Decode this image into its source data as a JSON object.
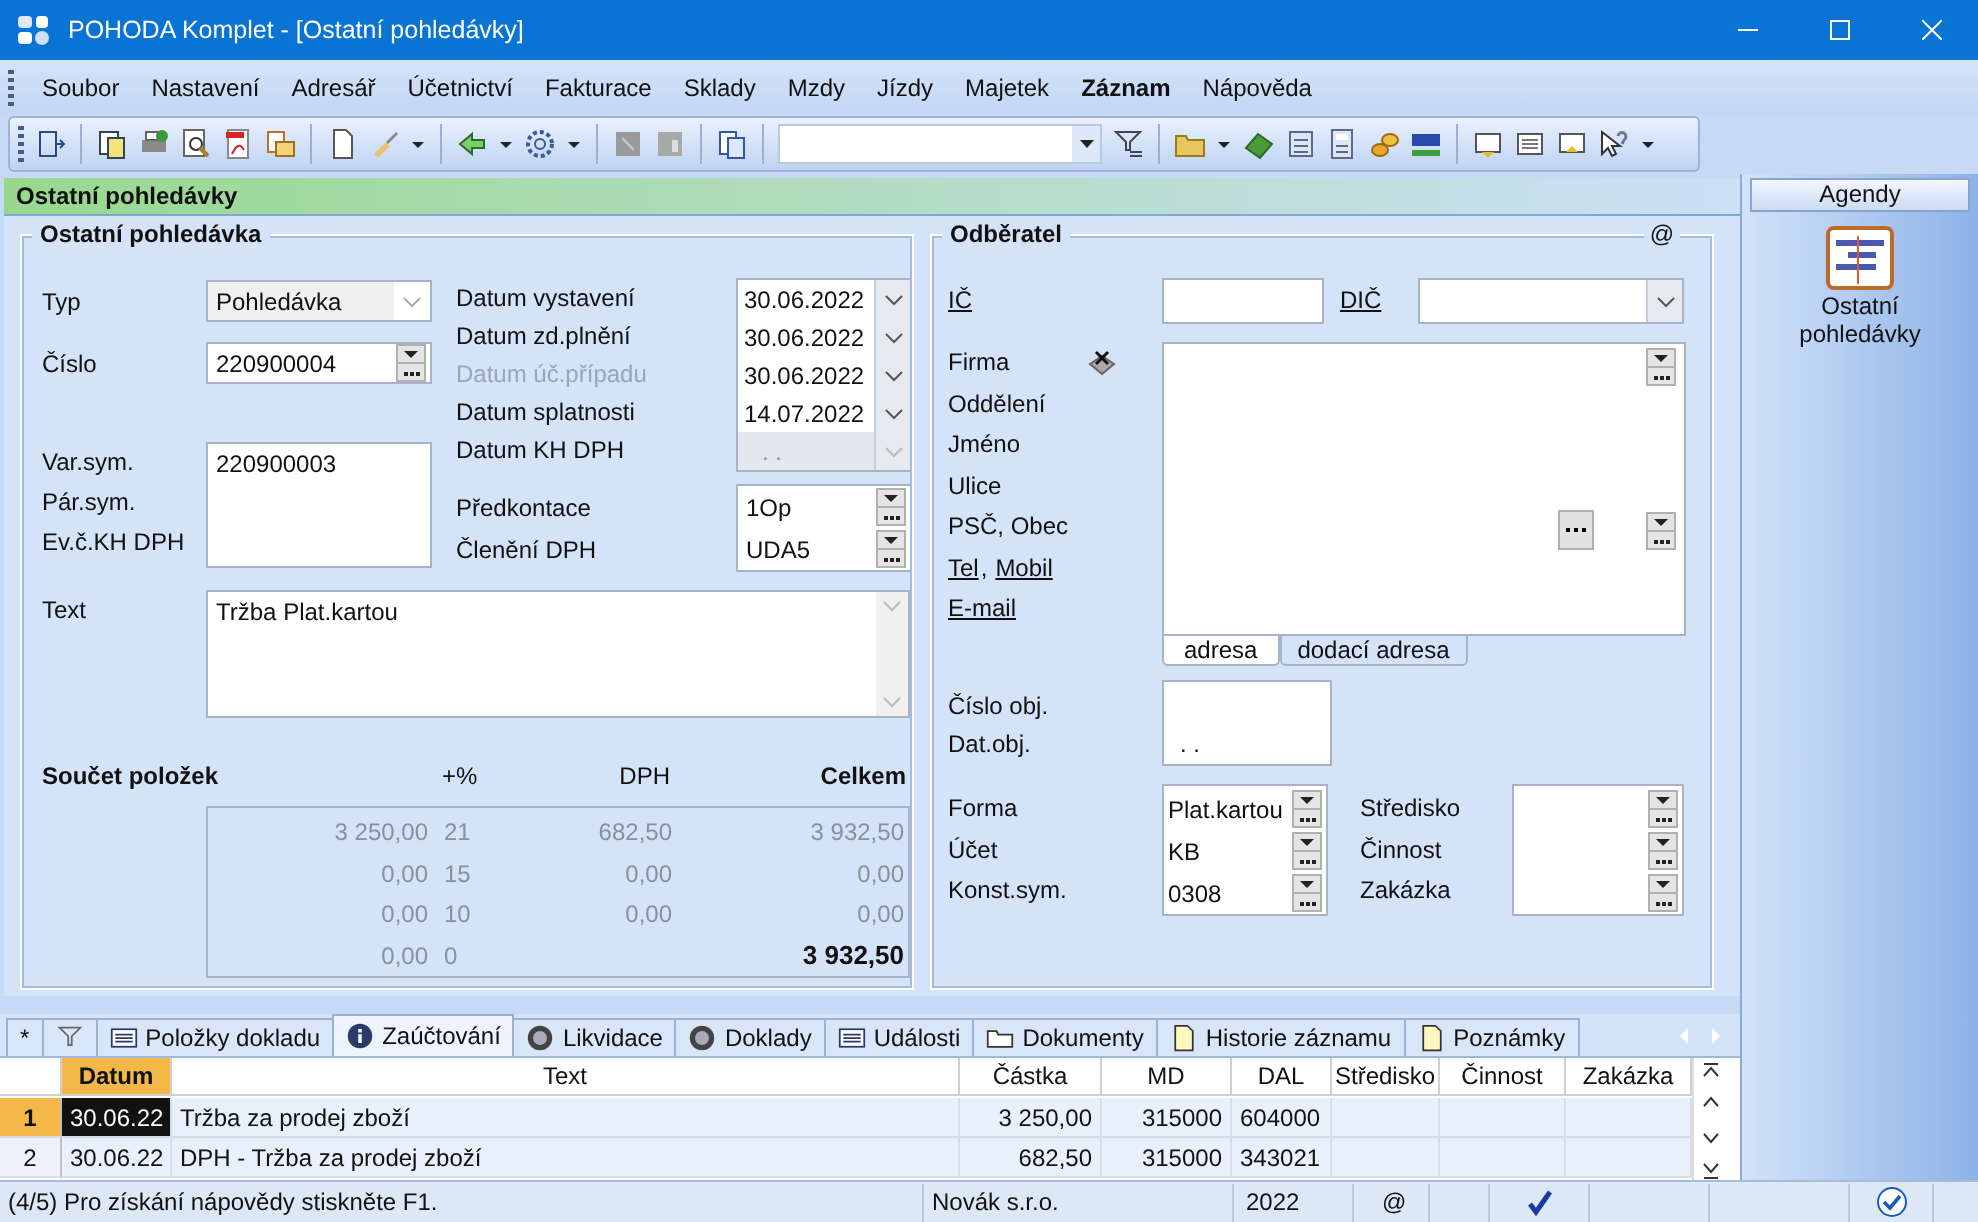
{
  "window": {
    "title": "POHODA Komplet - [Ostatní pohledávky]"
  },
  "menu": [
    {
      "label": "Soubor",
      "bold": false
    },
    {
      "label": "Nastavení",
      "bold": false
    },
    {
      "label": "Adresář",
      "bold": false
    },
    {
      "label": "Účetnictví",
      "bold": false
    },
    {
      "label": "Fakturace",
      "bold": false
    },
    {
      "label": "Sklady",
      "bold": false
    },
    {
      "label": "Mzdy",
      "bold": false
    },
    {
      "label": "Jízdy",
      "bold": false
    },
    {
      "label": "Majetek",
      "bold": false
    },
    {
      "label": "Záznam",
      "bold": true
    },
    {
      "label": "Nápověda",
      "bold": false
    }
  ],
  "agenda_header": "Ostatní pohledávky",
  "document": {
    "title": "Ostatní pohledávka",
    "typ": {
      "label": "Typ",
      "value": "Pohledávka"
    },
    "cislo": {
      "label": "Číslo",
      "value": "220900004"
    },
    "symbols": {
      "labels": [
        "Var.sym.",
        "Pár.sym.",
        "Ev.č.KH DPH"
      ],
      "values": [
        "220900003"
      ]
    },
    "dates": [
      {
        "label": "Datum vystavení",
        "value": "30.06.2022",
        "label_disabled": false,
        "disabled": false
      },
      {
        "label": "Datum zd.plnění",
        "value": "30.06.2022",
        "label_disabled": false,
        "disabled": false
      },
      {
        "label": "Datum úč.případu",
        "value": "30.06.2022",
        "label_disabled": true,
        "disabled": false
      },
      {
        "label": "Datum splatnosti",
        "value": "14.07.2022",
        "label_disabled": false,
        "disabled": false
      },
      {
        "label": "Datum KH DPH",
        "value": ". .",
        "label_disabled": false,
        "disabled": true
      }
    ],
    "accounting": [
      {
        "label": "Předkontace",
        "value": "1Op"
      },
      {
        "label": "Členění DPH",
        "value": "UDA5"
      }
    ],
    "text": {
      "label": "Text",
      "value": "Tržba Plat.kartou"
    },
    "totals": {
      "title": "Součet položek",
      "columns": [
        "+%",
        "DPH",
        "Celkem"
      ],
      "rows": [
        {
          "kind": "rate",
          "base": "3 250,00",
          "rate": "21",
          "vat": "682,50",
          "total": "3 932,50"
        },
        {
          "kind": "rate",
          "base": "0,00",
          "rate": "15",
          "vat": "0,00",
          "total": "0,00"
        },
        {
          "kind": "rate",
          "base": "0,00",
          "rate": "10",
          "vat": "0,00",
          "total": "0,00"
        },
        {
          "kind": "sum",
          "base": "0,00",
          "rate": "0",
          "total": "3 932,50"
        }
      ]
    }
  },
  "customer": {
    "title": "Odběratel",
    "email_mark": "@",
    "ic": {
      "label": "IČ",
      "link": true
    },
    "dic": {
      "label": "DIČ",
      "link": true
    },
    "address_rows": [
      {
        "items": [
          {
            "text": "Firma",
            "link": false
          }
        ]
      },
      {
        "items": [
          {
            "text": "Oddělení",
            "link": false
          }
        ]
      },
      {
        "items": [
          {
            "text": "Jméno",
            "link": false
          }
        ]
      },
      {
        "items": [
          {
            "text": "Ulice",
            "link": false
          }
        ]
      },
      {
        "items": [
          {
            "text": "PSČ, Obec",
            "link": false
          }
        ]
      },
      {
        "items": [
          {
            "text": "Tel",
            "link": true
          },
          {
            "text": ",",
            "link": false
          },
          {
            "text": "Mobil",
            "link": true
          }
        ]
      },
      {
        "items": [
          {
            "text": "E-mail",
            "link": true
          }
        ]
      }
    ],
    "address_tabs": [
      {
        "label": "adresa",
        "selected": true
      },
      {
        "label": "dodací adresa",
        "selected": false
      }
    ],
    "order": {
      "labels": [
        "Číslo obj.",
        "Dat.obj."
      ],
      "date": ". ."
    },
    "payment": [
      {
        "label": "Forma",
        "value": "Plat.kartou"
      },
      {
        "label": "Účet",
        "value": "KB"
      },
      {
        "label": "Konst.sym.",
        "value": "0308"
      }
    ],
    "assignment": {
      "labels": [
        "Středisko",
        "Činnost",
        "Zakázka"
      ]
    }
  },
  "agendas": {
    "title": "Agendy",
    "items": [
      {
        "label": "Ostatní pohledávky"
      }
    ]
  },
  "tabs": [
    {
      "kind": "text",
      "label": "*",
      "selected": false
    },
    {
      "kind": "filter",
      "selected": false
    },
    {
      "kind": "list",
      "label": "Položky dokladu",
      "selected": false
    },
    {
      "kind": "info",
      "label": "Zaúčtování",
      "selected": true
    },
    {
      "kind": "disc",
      "label": "Likvidace",
      "selected": false
    },
    {
      "kind": "disc",
      "label": "Doklady",
      "selected": false
    },
    {
      "kind": "list",
      "label": "Události",
      "selected": false
    },
    {
      "kind": "folder",
      "label": "Dokumenty",
      "selected": false
    },
    {
      "kind": "page",
      "label": "Historie záznamu",
      "selected": false
    },
    {
      "kind": "page",
      "label": "Poznámky",
      "selected": false
    }
  ],
  "grid": {
    "columns": [
      {
        "label": "Datum",
        "sorted": true
      },
      {
        "label": "Text",
        "sorted": false
      },
      {
        "label": "Částka",
        "sorted": false
      },
      {
        "label": "MD",
        "sorted": false
      },
      {
        "label": "DAL",
        "sorted": false
      },
      {
        "label": "Středisko",
        "sorted": false
      },
      {
        "label": "Činnost",
        "sorted": false
      },
      {
        "label": "Zakázka",
        "sorted": false
      }
    ],
    "rows": [
      {
        "number": "1",
        "selected": true,
        "cells": [
          "30.06.22",
          "Tržba za prodej zboží",
          "3 250,00",
          "315000",
          "604000"
        ]
      },
      {
        "number": "2",
        "selected": false,
        "cells": [
          "30.06.22",
          "DPH - Tržba za prodej zboží",
          "682,50",
          "315000",
          "343021"
        ]
      }
    ]
  },
  "status": {
    "message": "(4/5) Pro získání nápovědy stiskněte F1.",
    "company": "Novák s.r.o.",
    "year": "2022",
    "email": "@"
  }
}
